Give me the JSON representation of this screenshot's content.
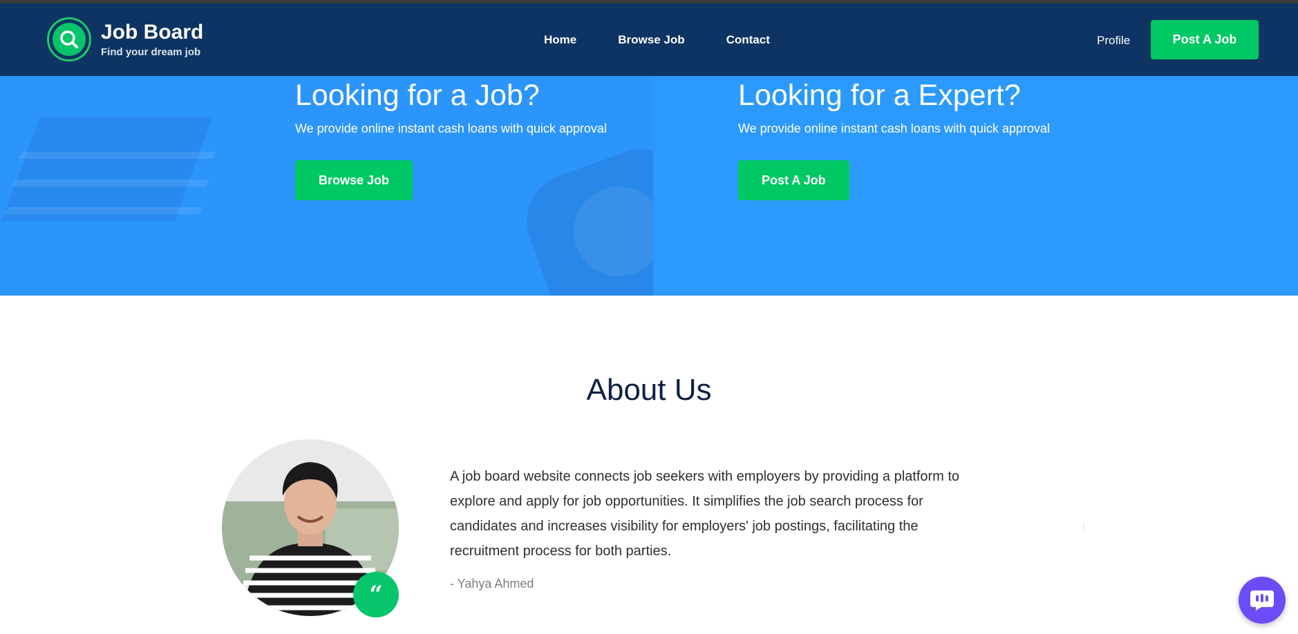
{
  "header": {
    "logo_title": "Job Board",
    "logo_subtitle": "Find your dream job",
    "nav": [
      {
        "label": "Home"
      },
      {
        "label": "Browse Job"
      },
      {
        "label": "Contact"
      }
    ],
    "profile_label": "Profile",
    "post_job_label": "Post A Job"
  },
  "hero": {
    "left": {
      "title": "Looking for a Job?",
      "text": "We provide online instant cash loans with quick approval",
      "button": "Browse Job"
    },
    "right": {
      "title": "Looking for a Expert?",
      "text": "We provide online instant cash loans with quick approval",
      "button": "Post A Job"
    }
  },
  "about": {
    "title": "About Us",
    "text": "A job board website connects job seekers with employers by providing a platform to explore and apply for job opportunities. It simplifies the job search process for candidates and increases visibility for employers' job postings, facilitating the recruitment process for both parties.",
    "author": "- Yahya Ahmed",
    "quote_icon": "“"
  },
  "icons": {
    "logo": "search-icon",
    "quote": "quote-icon",
    "chat": "chat-icon"
  },
  "colors": {
    "header_bg": "#0d3462",
    "accent_green": "#00c864",
    "hero_blue": "#2c95fb",
    "chat_purple": "#6c4cf6"
  }
}
